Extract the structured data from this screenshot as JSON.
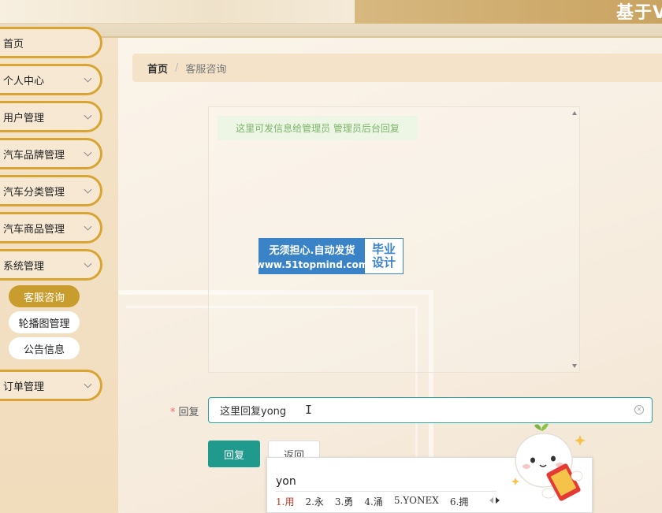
{
  "header": {
    "title": "基于V"
  },
  "sidebar": {
    "items": [
      {
        "label": "首页"
      },
      {
        "label": "个人中心"
      },
      {
        "label": "用户管理"
      },
      {
        "label": "汽车品牌管理"
      },
      {
        "label": "汽车分类管理"
      },
      {
        "label": "汽车商品管理"
      },
      {
        "label": "系统管理"
      },
      {
        "label": "订单管理"
      }
    ],
    "sub_items": [
      {
        "label": "客服咨询",
        "active": true
      },
      {
        "label": "轮播图管理",
        "active": false
      },
      {
        "label": "公告信息",
        "active": false
      }
    ]
  },
  "breadcrumb": {
    "home": "首页",
    "separator": "/",
    "current": "客服咨询"
  },
  "chat": {
    "messages": [
      {
        "text": "这里可发信息给管理员 管理员后台回复"
      }
    ]
  },
  "watermark": {
    "line1": "无须担心.自动发货",
    "line2": "www.51topmind.com",
    "right1": "毕业",
    "right2": "设计"
  },
  "form": {
    "required_mark": "*",
    "reply_label": "回复",
    "reply_value": "这里回复yong",
    "reply_button": "回复",
    "back_button": "返回"
  },
  "ime": {
    "composition": "yon",
    "candidates": [
      "1.用",
      "2.永",
      "3.勇",
      "4.涌",
      "5.YONEX",
      "6.拥"
    ]
  },
  "colors": {
    "accent_gold": "#d8a534",
    "active_sub": "#c99c2e",
    "primary_button": "#1f9a8c",
    "message_bg": "#edf5e4",
    "message_text": "#7cb56b",
    "watermark_blue": "#3b83c7"
  },
  "icons": {
    "menu_expand": "chevron-down-icon",
    "clear": "circle-close-icon",
    "ime_page": "caret-left-right-icon"
  }
}
